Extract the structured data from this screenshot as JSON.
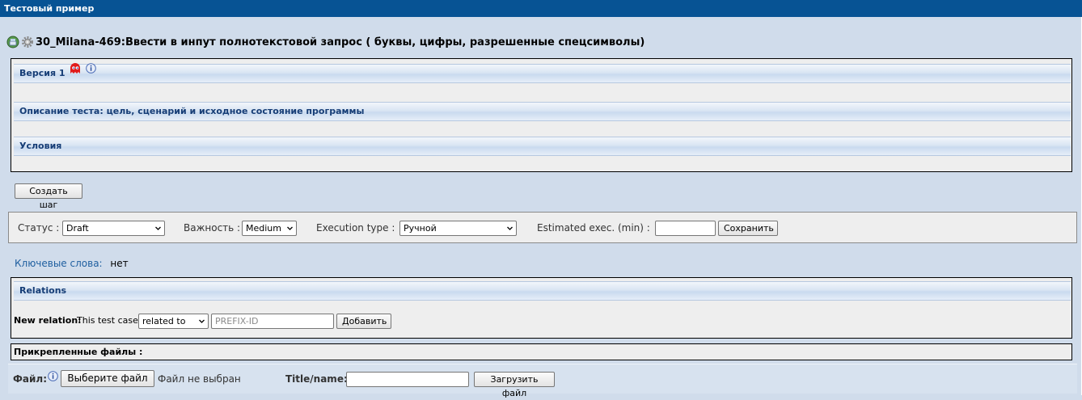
{
  "window": {
    "title": "Тестовый пример"
  },
  "testcase": {
    "title": "30_Milana-469:Ввести в инпут полнотекстовой запрос ( буквы, цифры, разрешенные спецсимволы)"
  },
  "sections": {
    "version": "Версия 1",
    "description": "Описание теста: цель, сценарий и исходное состояние программы",
    "conditions": "Условия"
  },
  "buttons": {
    "create_step": "Создать шаг",
    "save": "Сохранить",
    "add": "Добавить",
    "choose_file": "Выберите файл",
    "upload": "Загрузить файл"
  },
  "attributes": {
    "status_label": "Статус :",
    "status_value": "Draft",
    "importance_label": "Важность :",
    "importance_value": "Medium",
    "exec_type_label": "Execution type :",
    "exec_type_value": "Ручной",
    "estimated_label": "Estimated exec. (min) :",
    "estimated_value": ""
  },
  "keywords": {
    "label": "Ключевые слова",
    "separator": ":",
    "value": "нет"
  },
  "relations": {
    "title": "Relations",
    "new_label": "New relation:",
    "this_case": "This test case",
    "relation_value": "related to",
    "prefix_placeholder": "PREFIX-ID"
  },
  "attachments": {
    "title": "Прикрепленные файлы :",
    "file_label": "Файл:",
    "no_file": "Файл не выбран",
    "title_name_label": "Title/name:",
    "title_name_value": ""
  },
  "colors": {
    "titlebar": "#075394",
    "background": "#d0dceb",
    "section_text": "#163d76",
    "keywords_link": "#1f5fa0"
  }
}
